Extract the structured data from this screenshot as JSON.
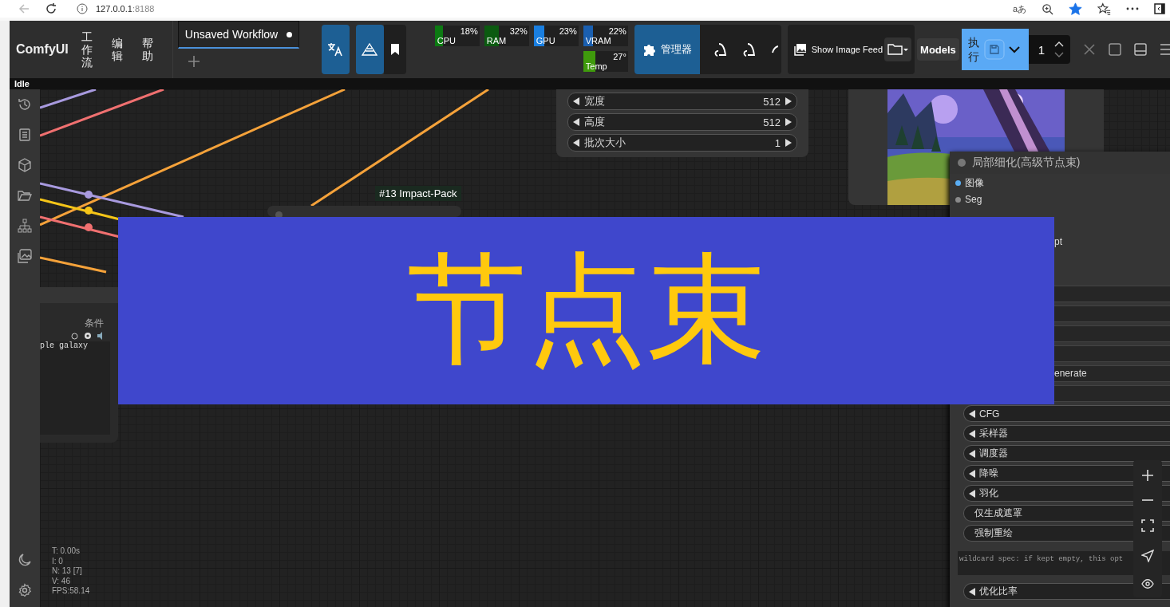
{
  "browser": {
    "url_host": "127.0.0.1",
    "url_port": ":8188",
    "read_aloud": "aあ",
    "favorited": true
  },
  "app": {
    "logo": "ComfyUI",
    "menus": [
      "工作流",
      "编辑",
      "帮助"
    ],
    "tabs": [
      {
        "label": "Unsaved Workflow",
        "modified": true,
        "selected": true
      }
    ],
    "monitors": [
      {
        "label": "CPU",
        "value": "18%",
        "level": 0.18,
        "color": "#0c7a12"
      },
      {
        "label": "RAM",
        "value": "32%",
        "level": 0.32,
        "color": "#0b5a10"
      },
      {
        "label": "GPU",
        "value": "23%",
        "level": 0.23,
        "color": "#1a7fe0"
      },
      {
        "label": "VRAM",
        "value": "22%",
        "level": 0.22,
        "color": "#1a5fb0"
      },
      {
        "label": "Temp",
        "value": "27°",
        "level": 0.27,
        "color": "#3f9a0c"
      }
    ],
    "manager_label": "管理器",
    "feed_label": "Show Image Feed",
    "models_label": "Models",
    "run_label": "执行",
    "queue_count": "1"
  },
  "status": "Idle",
  "canvas": {
    "size_node": {
      "widgets": [
        {
          "label": "宽度",
          "value": "512"
        },
        {
          "label": "高度",
          "value": "512"
        },
        {
          "label": "批次大小",
          "value": "1"
        }
      ]
    },
    "tag": "#13 Impact-Pack",
    "prompt_node": {
      "label": "条件",
      "text": "ple galaxy"
    },
    "detailer": {
      "title": "局部细化(高级节点束)",
      "inputs": [
        {
          "label": "图像",
          "color": "#5aaef5"
        },
        {
          "label": "Seg",
          "color": "#8a8a8a"
        }
      ],
      "partial_texts": [
        "pt",
        "enerate"
      ],
      "widgets": [
        {
          "kind": "number",
          "label": "CFG"
        },
        {
          "kind": "number",
          "label": "采样器"
        },
        {
          "kind": "number",
          "label": "调度器"
        },
        {
          "kind": "number",
          "label": "降噪"
        },
        {
          "kind": "number",
          "label": "羽化"
        },
        {
          "kind": "toggle",
          "label": "仅生成遮罩"
        },
        {
          "kind": "toggle",
          "label": "强制重绘"
        },
        {
          "kind": "text",
          "label": "wildcard spec: if kept empty, this opt"
        },
        {
          "kind": "number",
          "label": "优化比率"
        }
      ]
    },
    "stats": [
      "T: 0.00s",
      "I: 0",
      "N: 13 [7]",
      "V: 46",
      "FPS:58.14"
    ]
  },
  "banner": "节点束"
}
